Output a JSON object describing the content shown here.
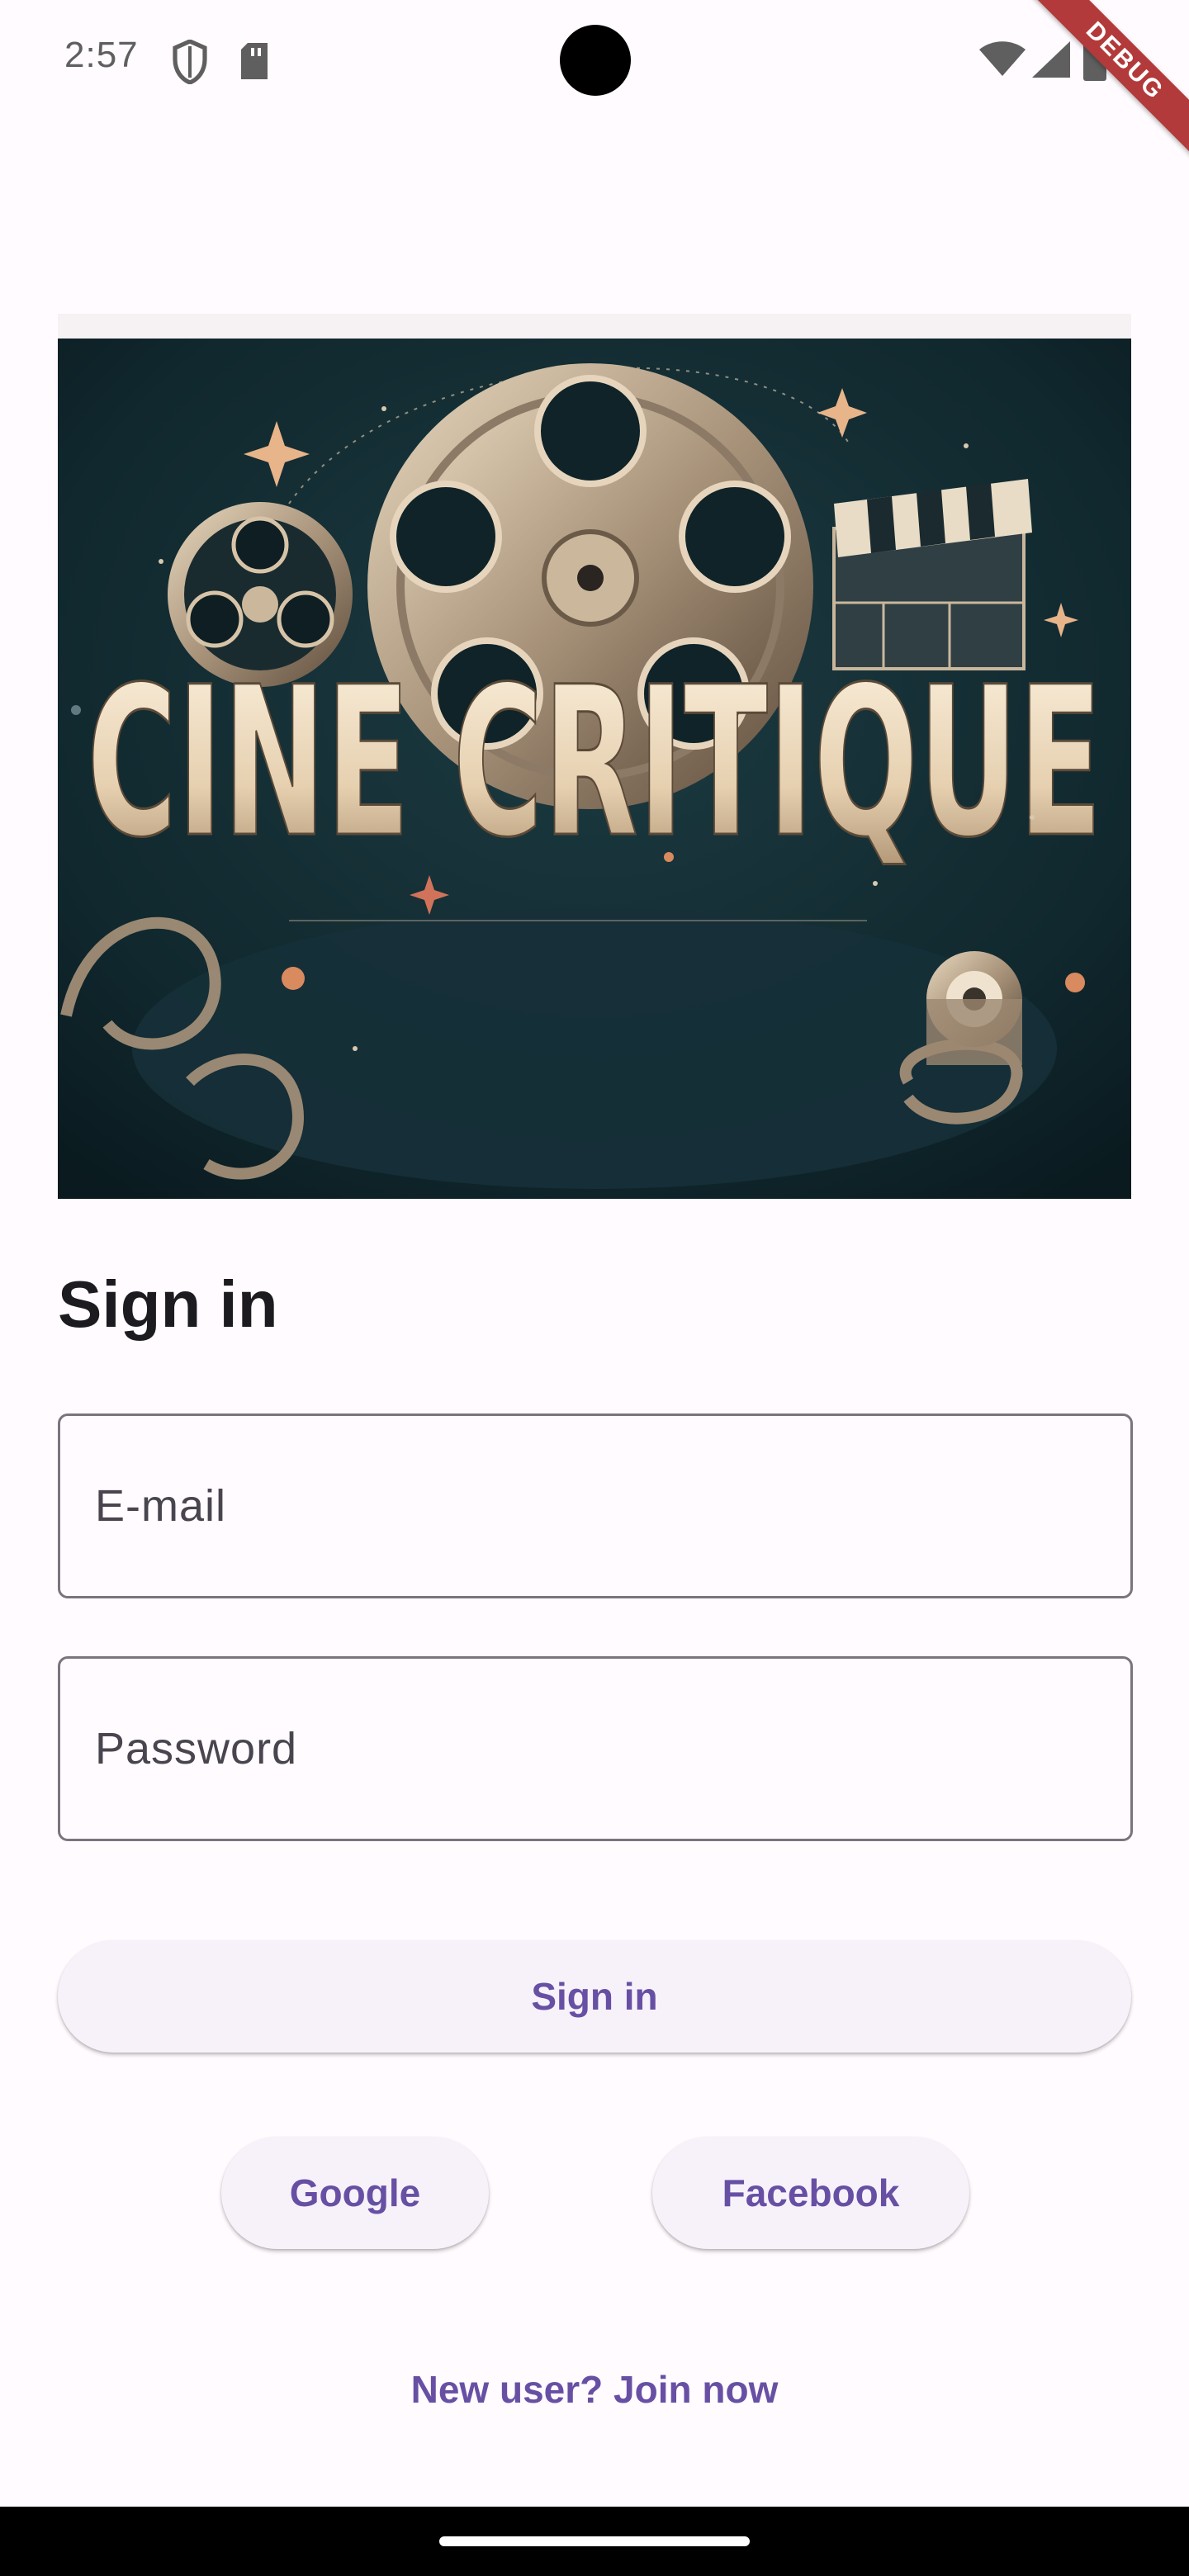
{
  "status_bar": {
    "time": "2:57",
    "icons": [
      "shield-icon",
      "sd-card-icon",
      "wifi-icon",
      "signal-icon",
      "battery-icon"
    ]
  },
  "debug_banner": {
    "label": "DEBUG",
    "color": "#b33a3a"
  },
  "hero": {
    "logo_text": "CINE CRITIQUE",
    "description_icons": [
      "film-reel-icon",
      "clapperboard-icon",
      "sparkle-icon"
    ]
  },
  "signin": {
    "title": "Sign in",
    "email_placeholder": "E-mail",
    "password_placeholder": "Password",
    "submit_label": "Sign in"
  },
  "social": {
    "google_label": "Google",
    "facebook_label": "Facebook"
  },
  "join": {
    "label": "New user? Join now"
  },
  "colors": {
    "background": "#FFFBFE",
    "primary": "#6750A4",
    "button_surface": "#F7F2FA",
    "outline": "#79747E",
    "hero_background": "#102a31"
  }
}
